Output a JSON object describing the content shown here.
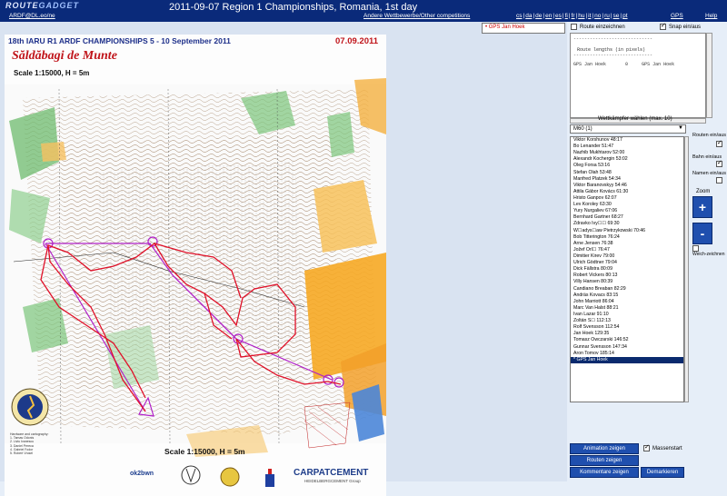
{
  "header": {
    "logo_text": "ROUTE",
    "logo_text2": "GADGET",
    "event_title": "2011-09-07 Region 1 Championships, Romania, 1st day",
    "ardf_link": "ARDF@DL.eo/ne",
    "other_competitions": "Andere Wettbewerbe/Other competitions",
    "languages": [
      "cs",
      "da",
      "de",
      "en",
      "es",
      "fi",
      "fr",
      "hu",
      "it",
      "no",
      "ru",
      "se",
      "pt"
    ],
    "gps_label": "GPS",
    "help_label": "Help"
  },
  "map": {
    "selected_runner_box": "• GPS Jan Hoek",
    "championship_title": "18th IARU R1 ARDF CHAMPIONSHIPS  5 - 10 September 2011",
    "date": "07.09.2011",
    "map_name": "Săldăbagi de Munte",
    "scale": "Scale 1:15000, H = 5m",
    "scale_bottom": "Scale 1:15000, H = 5m",
    "cartography_lines": [
      "Hardware and cartography:",
      "1. Tamas Odonis",
      "2. Liviu Ivanescu",
      "3. Daniel Pereca",
      "4. Gabriel Fodor",
      "5. Robert Vrosel"
    ],
    "sponsor_ok": "ok2bwn",
    "sponsor_carp": "CARPATCEMENT",
    "sponsor_carp_sub": "HEIDELBERGCEMENT Group"
  },
  "panel": {
    "route_draw_label": "Route einzeichnen",
    "snap_label": "Snap ein/aus",
    "route_lengths_title": "Route lengths (in pixels)",
    "route_lengths_rows": [
      {
        "name": "GPS Jan Hoek",
        "value": "0",
        "name2": "GPS Jan Hoek"
      }
    ],
    "runners_header": "Wettkämpfer wählen (max. 10)",
    "class_select": "M60 (1)",
    "runners": [
      "Viktor Korshunov 48:17",
      "Bo Lenander 51:47",
      "Nazhib Mukhtarov 52:00",
      "Alexandr Kochergin 53:02",
      "Oleg Forsa 53:16",
      "Stefan Olah 53:48",
      "Manfred Platzek 54:34",
      "Viktor Baranovskyy 54:46",
      "Attila Gábor Kovács 61:30",
      "Hristo Ganpov 62:07",
      "Lev Koroley 63:30",
      "Yury Nurgaliev 67:06",
      "Bernhard Gartner 68:27",
      "Zdravko Ivy☐☐ 69:30",
      "W☐adys☐aw Pietrzykowski 70:46",
      "Bob Titterington 76:24",
      "Arne Jensen 76:38",
      "Jožef Orl☐ 76:47",
      "Dimitier Kirev 79:00",
      "Ulrich Gödtner 79:04",
      "Dick Fällstra 80:09",
      "Robert Vickers 80:13",
      "Villy Hansen 80:39",
      "Candiano Breaban 82:29",
      "Andräs Kovacs 83:15",
      "John Marriott 86:04",
      "Marc Van Halst 88:21",
      "Ivan Lazar 91:10",
      "Zoltán S☐ 112:13",
      "Rolf Svensson 112:54",
      "Jan Hoek 129:35",
      "Tomasz Owczarski 146:52",
      "Gunnar Svensson 147:34",
      "Aron Tomov 185:14",
      "* GPS Jan Hoek"
    ],
    "selected_runner_index": 34,
    "routes_label": "Routen ein/aus",
    "bahn_label": "Bahn ein/aus",
    "names_label": "Namen ein/aus",
    "zoom_label": "Zoom",
    "zoom_in": "+",
    "zoom_out": "-",
    "weich_label": "Weich-zeichnen",
    "btn_animation": "Animation zeigen",
    "btn_routes": "Routen zeigen",
    "btn_comments": "Kommentare zeigen",
    "btn_mark": "Demarkieren",
    "massstart_label": "Massenstart"
  },
  "colors": {
    "header_bg": "#0a2a7a",
    "route_red": "#e01028",
    "course_purple": "#b020c8",
    "button_blue": "#1f4fae",
    "selected_row": "#0a2a6e"
  }
}
